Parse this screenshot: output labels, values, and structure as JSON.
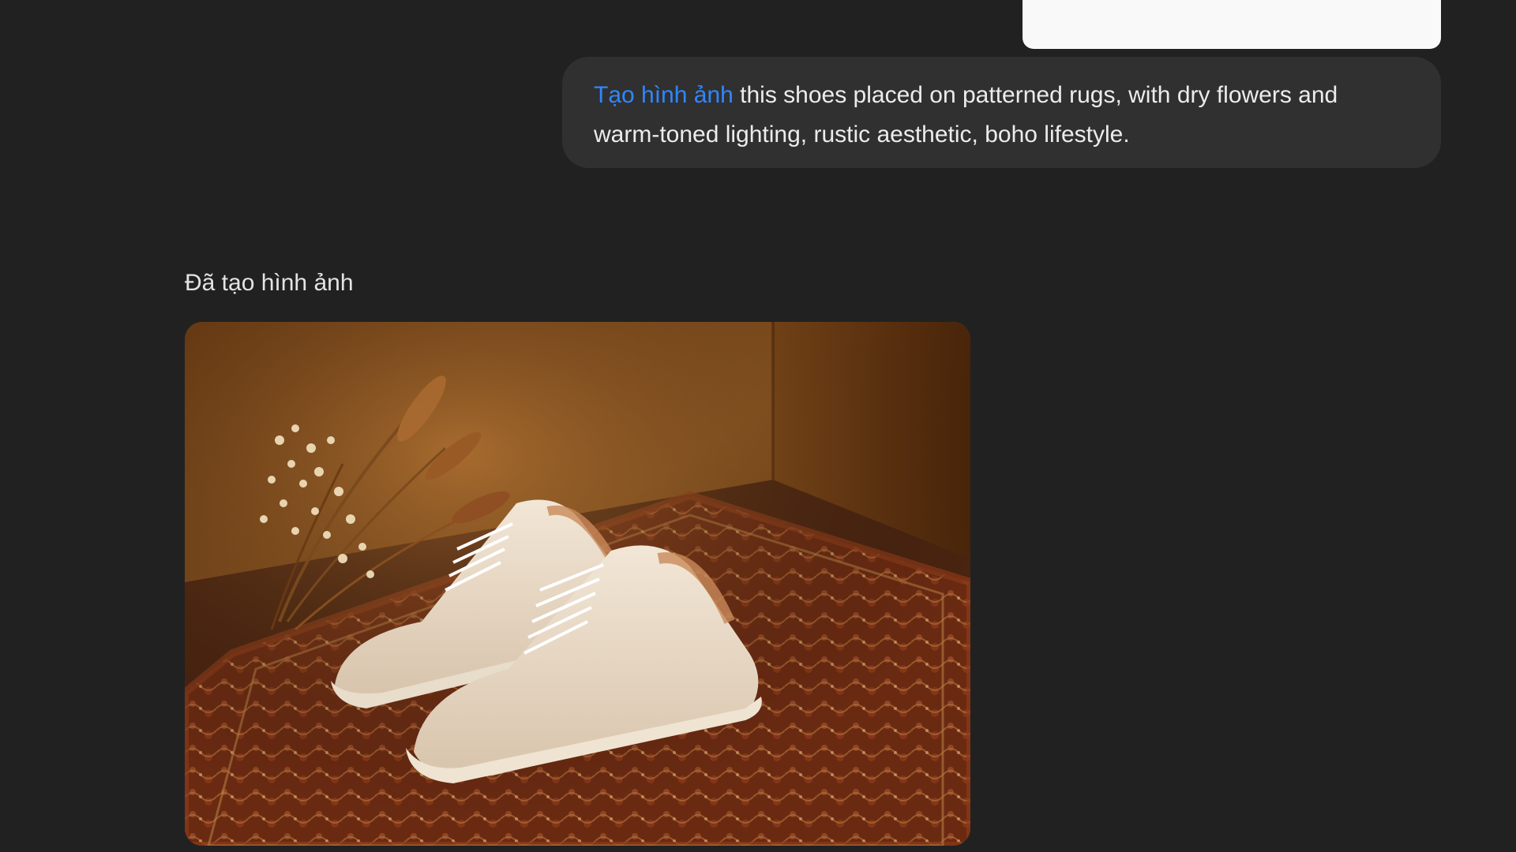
{
  "conversation": {
    "user_message": {
      "tool_tag": "Tạo hình ảnh",
      "text": " this shoes placed on patterned rugs, with dry flowers and warm-toned lighting, rustic aesthetic, boho lifestyle."
    },
    "assistant": {
      "status_label": "Đã tạo hình ảnh",
      "image": {
        "subject": "white leather sneakers on patterned rug with dried flowers, warm lighting"
      }
    }
  },
  "colors": {
    "background": "#212121",
    "bubble": "#303030",
    "tool_tag": "#2f87ff",
    "text": "#ececec"
  }
}
